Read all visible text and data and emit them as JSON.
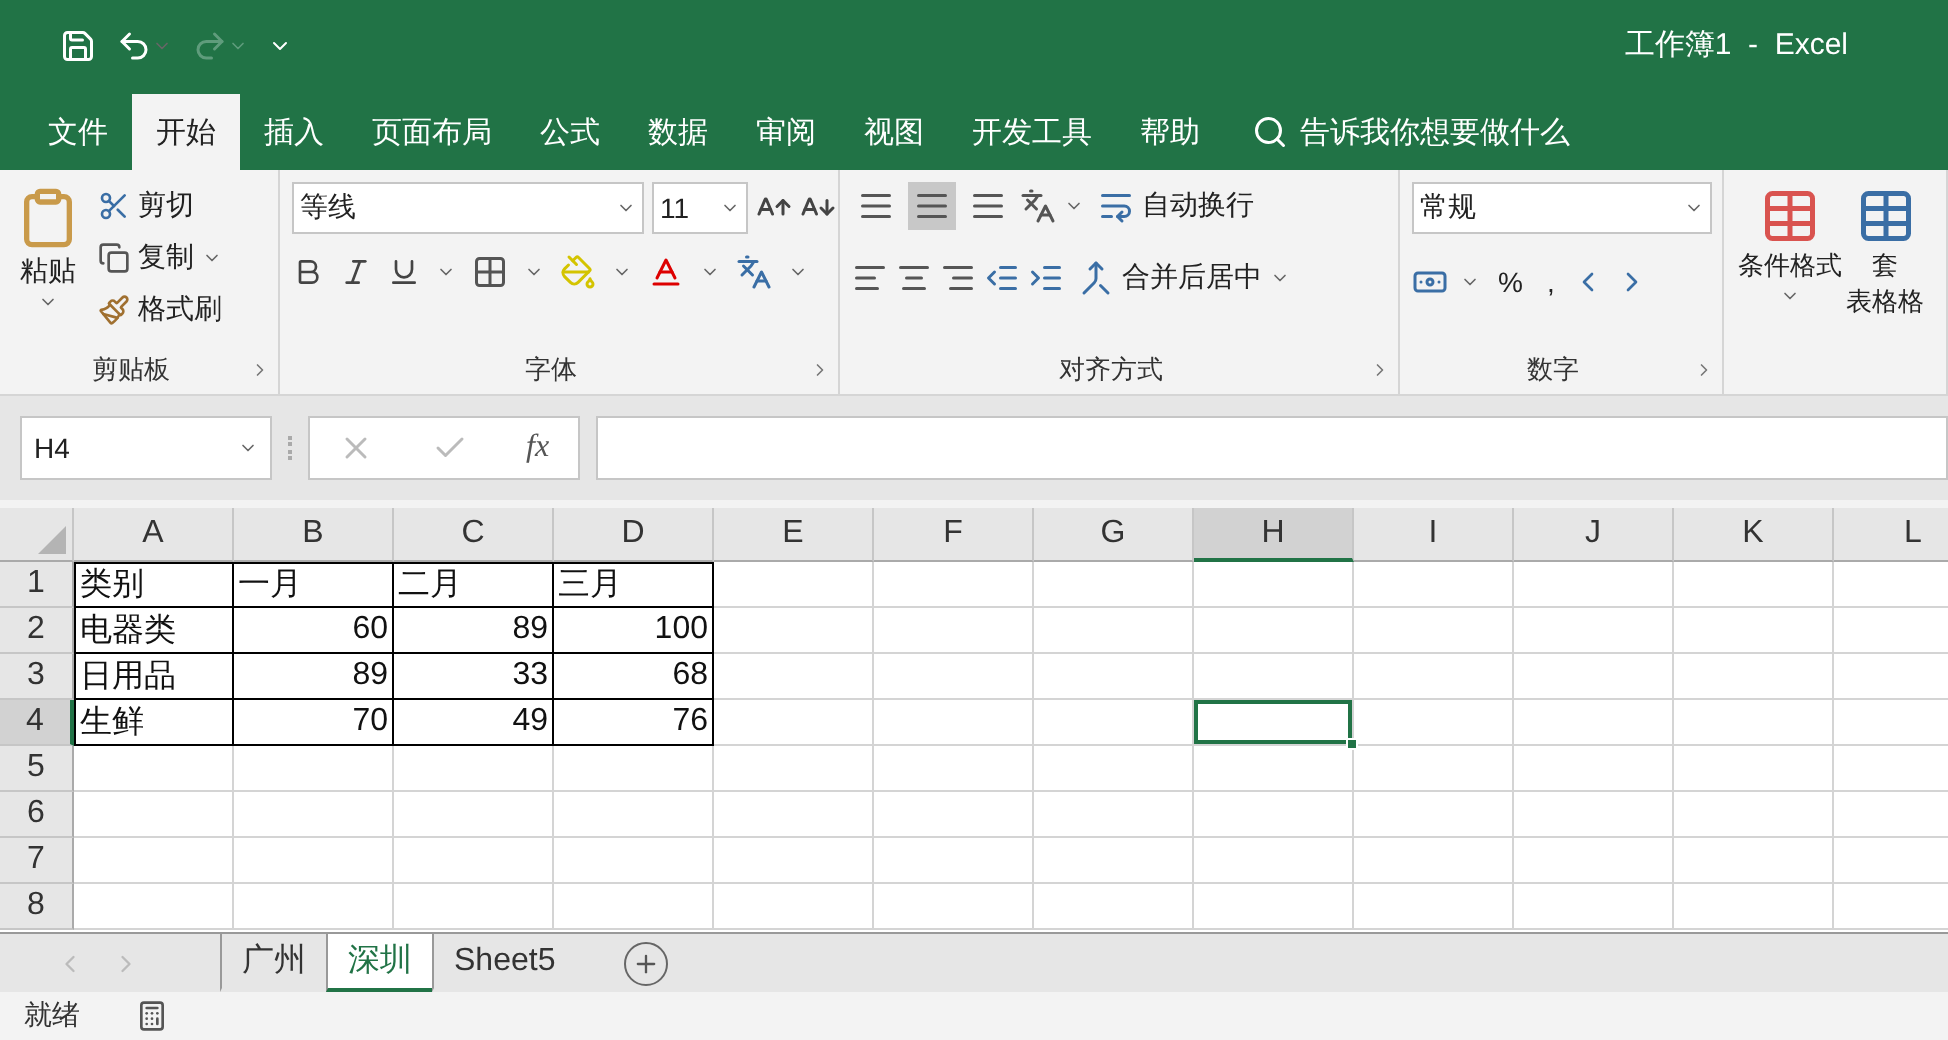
{
  "title_bar": {
    "title": "工作簿1  -  Excel",
    "redo_disabled": true
  },
  "menu_tabs": [
    {
      "label": "文件",
      "selected": false
    },
    {
      "label": "开始",
      "selected": true
    },
    {
      "label": "插入",
      "selected": false
    },
    {
      "label": "页面布局",
      "selected": false
    },
    {
      "label": "公式",
      "selected": false
    },
    {
      "label": "数据",
      "selected": false
    },
    {
      "label": "审阅",
      "selected": false
    },
    {
      "label": "视图",
      "selected": false
    },
    {
      "label": "开发工具",
      "selected": false
    },
    {
      "label": "帮助",
      "selected": false
    }
  ],
  "tell_me": {
    "placeholder": "告诉我你想要做什么"
  },
  "ribbon": {
    "clipboard": {
      "paste": "粘贴",
      "cut": "剪切",
      "copy": "复制",
      "format_painter": "格式刷",
      "label": "剪贴板"
    },
    "font": {
      "font_name": "等线",
      "font_size": "11",
      "label": "字体"
    },
    "alignment": {
      "wrap_text": "自动换行",
      "merge_center": "合并后居中",
      "label": "对齐方式",
      "center_selected": true
    },
    "number": {
      "format": "常规",
      "percent": "%",
      "comma": ",",
      "label": "数字"
    },
    "styles": {
      "conditional_format": "条件格式",
      "format_as_table_line1": "套",
      "format_as_table_line2": "表格格"
    }
  },
  "name_box": {
    "value": "H4"
  },
  "formula_bar": {
    "fx": "fx"
  },
  "grid": {
    "columns": [
      {
        "label": "A",
        "selected": false
      },
      {
        "label": "B",
        "selected": false
      },
      {
        "label": "C",
        "selected": false
      },
      {
        "label": "D",
        "selected": false
      },
      {
        "label": "E",
        "selected": false
      },
      {
        "label": "F",
        "selected": false
      },
      {
        "label": "G",
        "selected": false
      },
      {
        "label": "H",
        "selected": true
      },
      {
        "label": "I",
        "selected": false
      },
      {
        "label": "J",
        "selected": false
      },
      {
        "label": "K",
        "selected": false
      },
      {
        "label": "L",
        "selected": false
      }
    ],
    "rows": [
      {
        "label": "1",
        "selected": false,
        "cells": [
          {
            "kind": "text",
            "value": "类别"
          },
          {
            "kind": "text",
            "value": "一月"
          },
          {
            "kind": "text",
            "value": "二月"
          },
          {
            "kind": "text",
            "value": "三月"
          }
        ]
      },
      {
        "label": "2",
        "selected": false,
        "cells": [
          {
            "kind": "text",
            "value": "电器类"
          },
          {
            "kind": "number",
            "value": "60"
          },
          {
            "kind": "number",
            "value": "89"
          },
          {
            "kind": "number",
            "value": "100"
          }
        ]
      },
      {
        "label": "3",
        "selected": false,
        "cells": [
          {
            "kind": "text",
            "value": "日用品"
          },
          {
            "kind": "number",
            "value": "89"
          },
          {
            "kind": "number",
            "value": "33"
          },
          {
            "kind": "number",
            "value": "68"
          }
        ]
      },
      {
        "label": "4",
        "selected": true,
        "cells": [
          {
            "kind": "text",
            "value": "生鲜"
          },
          {
            "kind": "number",
            "value": "70"
          },
          {
            "kind": "number",
            "value": "49"
          },
          {
            "kind": "number",
            "value": "76"
          }
        ]
      },
      {
        "label": "5",
        "selected": false,
        "cells": []
      },
      {
        "label": "6",
        "selected": false,
        "cells": []
      },
      {
        "label": "7",
        "selected": false,
        "cells": []
      },
      {
        "label": "8",
        "selected": false,
        "cells": []
      }
    ]
  },
  "sheet_tabs": [
    {
      "label": "广州",
      "selected": false
    },
    {
      "label": "深圳",
      "selected": true
    },
    {
      "label": "Sheet5",
      "selected": false
    }
  ],
  "status_bar": {
    "text": "就绪"
  }
}
